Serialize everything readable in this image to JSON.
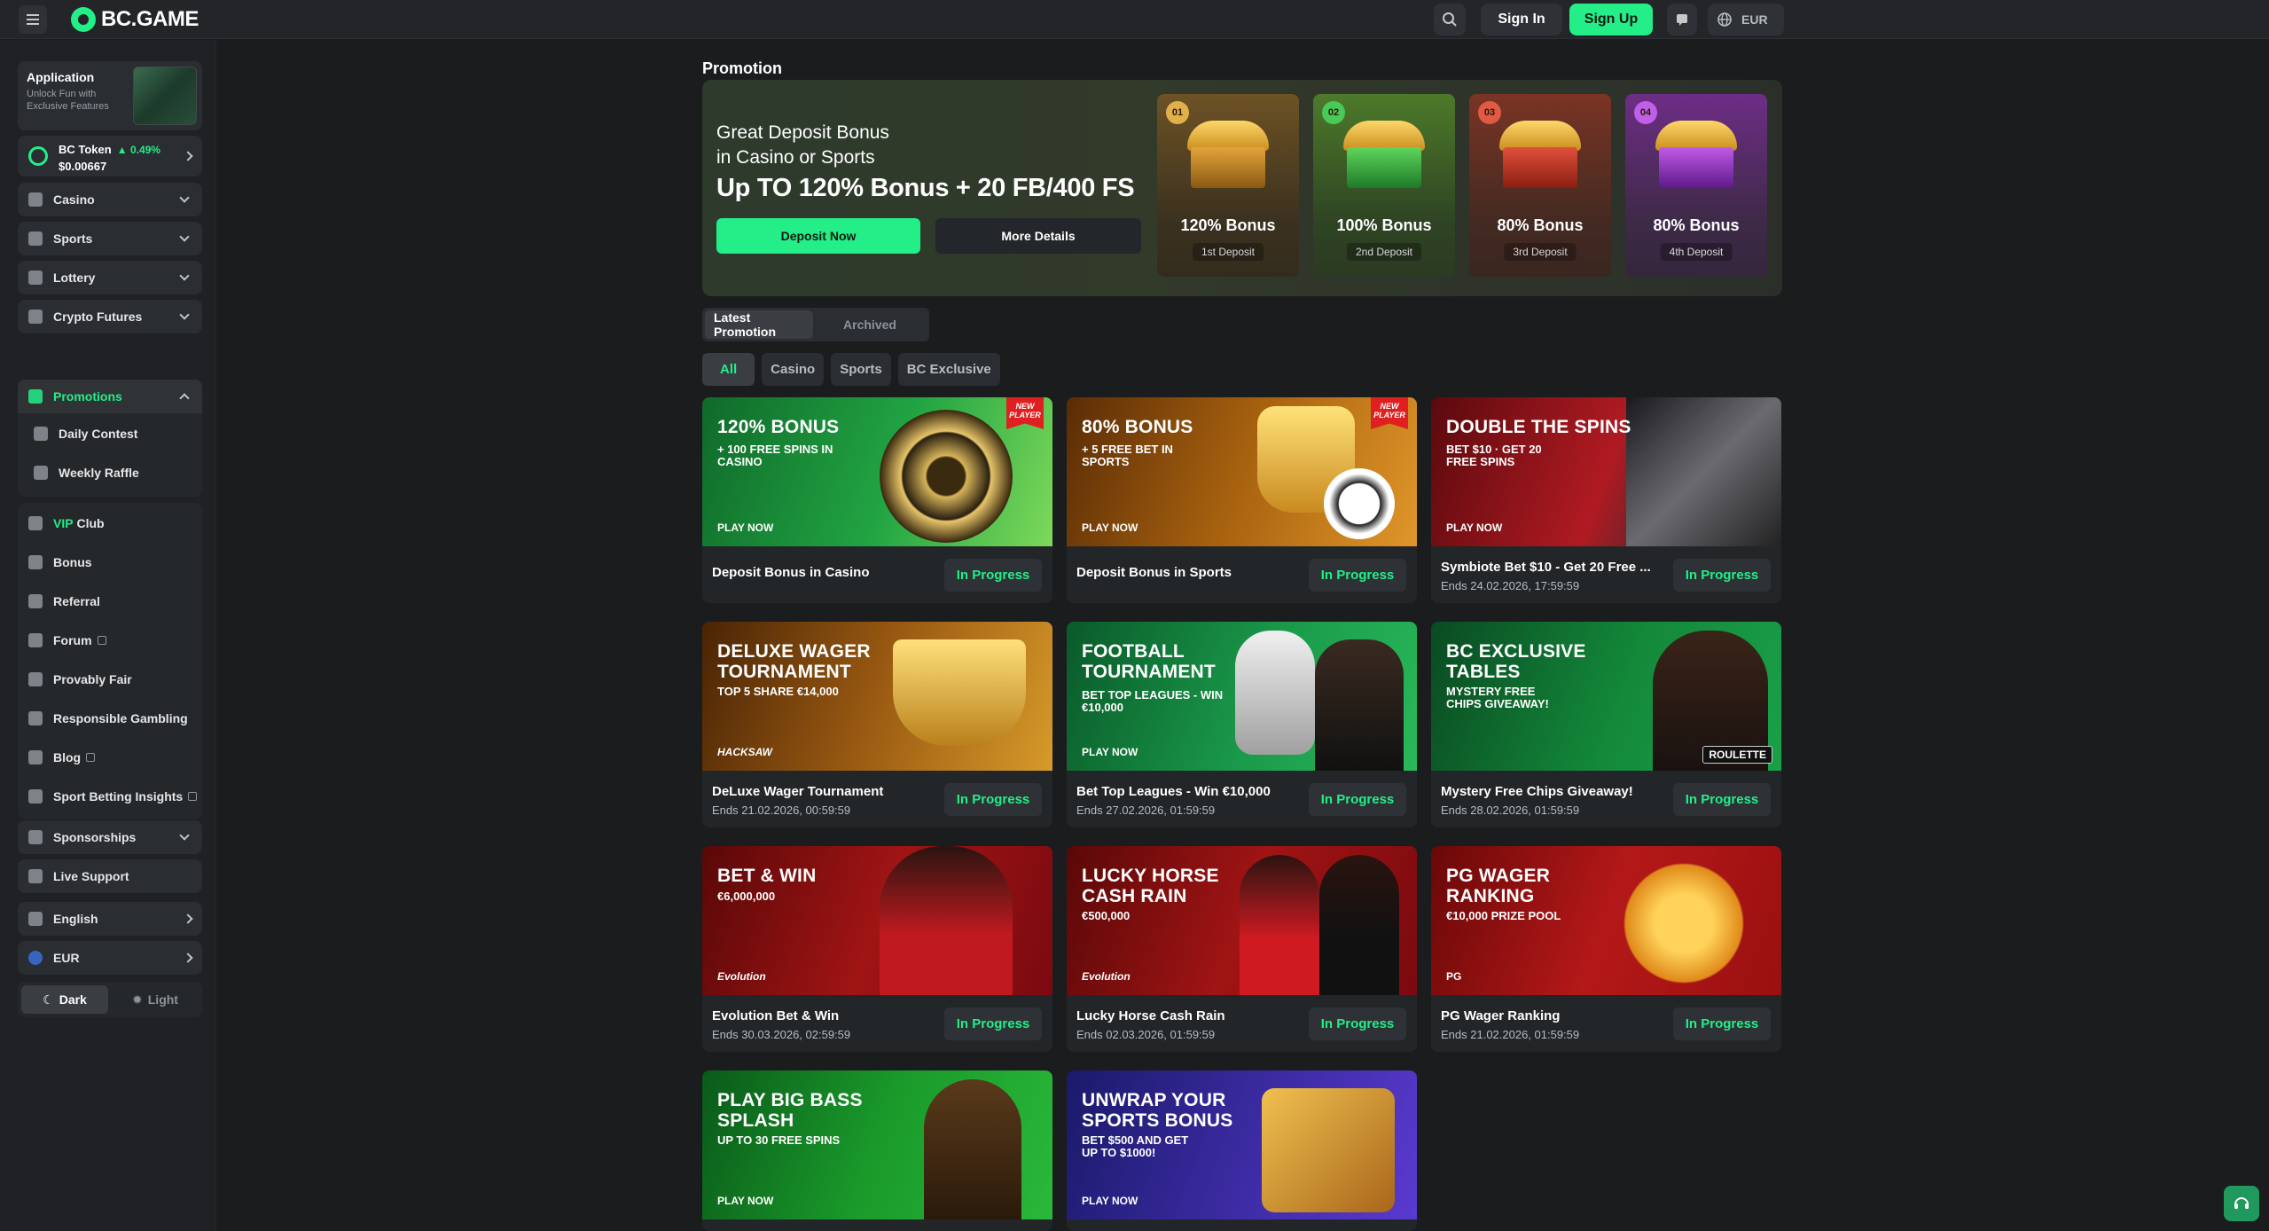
{
  "header": {
    "logo_text": "BC.GAME",
    "signin_label": "Sign In",
    "signup_label": "Sign Up",
    "currency": "EUR",
    "icons": [
      "menu-icon",
      "search-icon",
      "chat-icon",
      "globe-icon"
    ]
  },
  "sidebar": {
    "app_card": {
      "title": "Application",
      "subtitle": "Unlock Fun with Exclusive Features"
    },
    "token": {
      "name": "BC Token",
      "change": "0.49%",
      "price": "$0.00667"
    },
    "nav": [
      {
        "label": "Casino",
        "icon": "casino-icon"
      },
      {
        "label": "Sports",
        "icon": "sports-icon"
      },
      {
        "label": "Lottery",
        "icon": "lottery-icon"
      },
      {
        "label": "Crypto Futures",
        "icon": "futures-icon"
      },
      {
        "label": "Promotions",
        "icon": "promotions-icon"
      }
    ],
    "promo_sub": [
      {
        "label": "Daily Contest",
        "icon": "contest-icon"
      },
      {
        "label": "Weekly Raffle",
        "icon": "raffle-icon"
      }
    ],
    "vip_prefix": "VIP",
    "vip_suffix": "Club",
    "misc": [
      {
        "label": "Bonus",
        "icon": "gift-icon"
      },
      {
        "label": "Referral",
        "icon": "referral-icon"
      },
      {
        "label": "Forum",
        "icon": "forum-icon"
      },
      {
        "label": "Provably Fair",
        "icon": "fair-icon"
      },
      {
        "label": "Responsible Gambling",
        "icon": "responsible-icon"
      },
      {
        "label": "Blog",
        "icon": "blog-icon"
      },
      {
        "label": "Sport Betting Insights",
        "icon": "insights-icon"
      }
    ],
    "sponsorships": "Sponsorships",
    "live_support": "Live Support",
    "language": "English",
    "currency": "EUR",
    "theme": {
      "dark": "Dark",
      "light": "Light",
      "selected": "dark"
    }
  },
  "main": {
    "page_title": "Promotion",
    "hero": {
      "line1": "Great Deposit Bonus",
      "line2": "in Casino or Sports",
      "headline": "Up TO 120% Bonus + 20 FB/400 FS",
      "deposit_label": "Deposit Now",
      "details_label": "More Details",
      "tiers": [
        {
          "num": "01",
          "bonus": "120% Bonus",
          "label": "1st Deposit",
          "color": "#e0a630"
        },
        {
          "num": "02",
          "bonus": "100% Bonus",
          "label": "2nd Deposit",
          "color": "#3fbf4a"
        },
        {
          "num": "03",
          "bonus": "80% Bonus",
          "label": "3rd Deposit",
          "color": "#d44a3a"
        },
        {
          "num": "04",
          "bonus": "80% Bonus",
          "label": "4th Deposit",
          "color": "#b040d8"
        }
      ]
    },
    "tabs": [
      "Latest Promotion",
      "Archived"
    ],
    "filters": [
      "All",
      "Casino",
      "Sports",
      "BC Exclusive"
    ],
    "status_label": "In Progress",
    "cards": [
      {
        "headline": "120% BONUS",
        "sub": "+ 100 FREE SPINS IN CASINO",
        "cta": "PLAY NOW",
        "ribbon": "NEW PLAYER",
        "title": "Deposit Bonus in Casino",
        "ends": ""
      },
      {
        "headline": "80% BONUS",
        "sub": "+ 5 FREE BET IN SPORTS",
        "cta": "PLAY NOW",
        "ribbon": "NEW PLAYER",
        "title": "Deposit Bonus in Sports",
        "ends": ""
      },
      {
        "headline": "DOUBLE THE SPINS",
        "sub": "BET $10 · GET 20 FREE SPINS",
        "cta": "PLAY NOW",
        "ribbon": "",
        "title": "Symbiote Bet $10 - Get 20 Free ...",
        "ends": "Ends 24.02.2026, 17:59:59"
      },
      {
        "headline": "DELUXE WAGER TOURNAMENT",
        "sub": "TOP 5 SHARE €14,000",
        "cta": "HACKSAW",
        "ribbon": "",
        "title": "DeLuxe Wager Tournament",
        "ends": "Ends 21.02.2026, 00:59:59"
      },
      {
        "headline": "FOOTBALL TOURNAMENT",
        "sub": "BET TOP LEAGUES - WIN €10,000",
        "cta": "PLAY NOW",
        "ribbon": "",
        "title": "Bet Top Leagues - Win €10,000",
        "ends": "Ends 27.02.2026, 01:59:59"
      },
      {
        "headline": "BC EXCLUSIVE TABLES",
        "sub": "MYSTERY FREE CHIPS GIVEAWAY!",
        "cta": "ROULETTE",
        "ribbon": "",
        "title": "Mystery Free Chips Giveaway!",
        "ends": "Ends 28.02.2026, 01:59:59"
      },
      {
        "headline": "BET & WIN",
        "sub": "€6,000,000",
        "cta": "Evolution",
        "ribbon": "",
        "title": "Evolution Bet & Win",
        "ends": "Ends 30.03.2026, 02:59:59"
      },
      {
        "headline": "LUCKY HORSE CASH RAIN",
        "sub": "€500,000",
        "cta": "Evolution",
        "ribbon": "",
        "title": "Lucky Horse Cash Rain",
        "ends": "Ends 02.03.2026, 01:59:59"
      },
      {
        "headline": "PG WAGER RANKING",
        "sub": "€10,000 PRIZE POOL",
        "cta": "PG",
        "ribbon": "",
        "title": "PG Wager Ranking",
        "ends": "Ends 21.02.2026, 01:59:59"
      },
      {
        "headline": "PLAY BIG BASS SPLASH",
        "sub": "UP TO 30 FREE SPINS",
        "cta": "PLAY NOW",
        "ribbon": ""
      },
      {
        "headline": "UNWRAP YOUR SPORTS BONUS",
        "sub": "BET $500 AND GET UP TO $1000!",
        "cta": "PLAY NOW",
        "ribbon": ""
      }
    ]
  },
  "colors": {
    "accent": "#23ee88",
    "bg": "#1a1c1e",
    "panel": "#232629"
  }
}
